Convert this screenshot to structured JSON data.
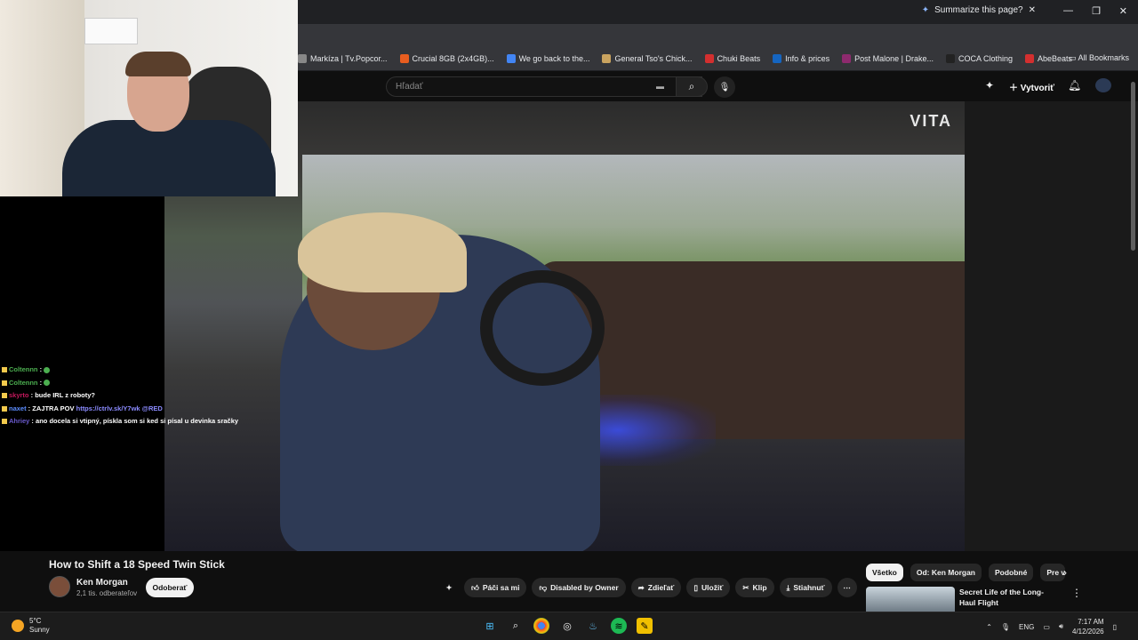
{
  "browser": {
    "summarize_label": "Summarize this page?",
    "all_bookmarks": "All Bookmarks",
    "bookmarks": [
      {
        "label": "Markíza | Tv.Popcor...",
        "color": "#888888"
      },
      {
        "label": "Crucial 8GB (2x4GB)...",
        "color": "#e85d1f"
      },
      {
        "label": "We go back to the...",
        "color": "#4285f4"
      },
      {
        "label": "General Tso's Chick...",
        "color": "#c9a35f"
      },
      {
        "label": "Chuki Beats",
        "color": "#d32f2f"
      },
      {
        "label": "Info & prices",
        "color": "#1565c0"
      },
      {
        "label": "Post Malone | Drake...",
        "color": "#8e2a6e"
      },
      {
        "label": "COCA Clothing",
        "color": "#222222"
      },
      {
        "label": "AbeBeats",
        "color": "#d32f2f"
      }
    ]
  },
  "youtube": {
    "search_placeholder": "Hľadať",
    "create_label": "Vytvoriť",
    "video_watermark": "VITA",
    "video_title": "How to Shift a 18 Speed Twin Stick",
    "channel_name": "Ken Morgan",
    "subscribers": "2,1 tis. odberateľov",
    "subscribe_label": "Odoberať",
    "actions": {
      "like": "Páči sa mi",
      "dislike": "Disabled by Owner",
      "share": "Zdieľať",
      "save": "Uložiť",
      "clip": "Klip",
      "download": "Stiahnuť"
    },
    "chips": [
      "Všetko",
      "Od: Ken Morgan",
      "Podobné",
      "Pre vás"
    ],
    "related": {
      "title": "Secret Life of the Long-Haul Flight"
    }
  },
  "chat": [
    {
      "user": "Coltennn",
      "sep": " :",
      "text": "",
      "user_color": "#4caf50",
      "emote": true
    },
    {
      "user": "Coltennn",
      "sep": " :",
      "text": "",
      "user_color": "#4caf50",
      "emote": true
    },
    {
      "user": "skyrto",
      "sep": " :",
      "text": "bude IRL z roboty?",
      "user_color": "#c2185b",
      "emote": false
    },
    {
      "user": "naxet",
      "sep": " :",
      "text": "ZAJTRA POV",
      "link": "https://ctrlv.sk/Y7wk @RED",
      "user_color": "#5c8dff",
      "emote": false
    },
    {
      "user": "Ahriey",
      "sep": " :",
      "text": "ano docela si vtipný, pískla som si ked si písal u devinka sračky",
      "user_color": "#6a5acd",
      "emote": false
    }
  ],
  "taskbar": {
    "temperature": "5°C",
    "condition": "Sunny",
    "language": "ENG",
    "time": "7:17 AM",
    "date": "4/12/2026"
  }
}
